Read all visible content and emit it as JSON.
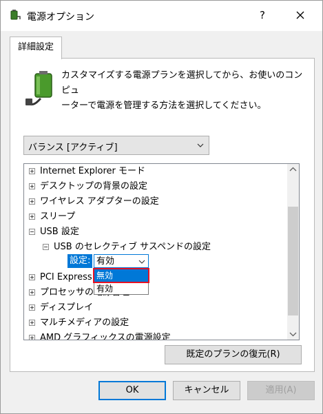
{
  "window": {
    "title": "電源オプション",
    "help_label": "?",
    "close_icon": "close-icon",
    "title_icon": "power-options-icon"
  },
  "tabs": [
    {
      "label": "詳細設定",
      "selected": true
    }
  ],
  "panel": {
    "description_line1": "カスタマイズする電源プランを選択してから、お使いのコンピュ",
    "description_line2": "ーターで電源を管理する方法を選択してください。",
    "icon": "battery-plug-icon"
  },
  "plan_select": {
    "value": "バランス [アクティブ]"
  },
  "tree": {
    "items": [
      {
        "label": "Internet Explorer モード",
        "expander": "plus"
      },
      {
        "label": "デスクトップの背景の設定",
        "expander": "plus"
      },
      {
        "label": "ワイヤレス アダプターの設定",
        "expander": "plus"
      },
      {
        "label": "スリープ",
        "expander": "plus"
      },
      {
        "label": "USB 設定",
        "expander": "minus"
      },
      {
        "label": "USB のセレクティブ サスペンドの設定",
        "expander": "minus"
      },
      {
        "label": "PCI Express",
        "expander": "plus"
      },
      {
        "label": "プロセッサの電源管理",
        "expander": "plus"
      },
      {
        "label": "ディスプレイ",
        "expander": "plus"
      },
      {
        "label": "マルチメディアの設定",
        "expander": "plus"
      },
      {
        "label": "AMD グラフィックスの電源設定",
        "expander": "plus"
      }
    ],
    "setting": {
      "label": "設定:",
      "value": "有効",
      "options": [
        "無効",
        "有効"
      ],
      "highlighted": "無効"
    }
  },
  "buttons": {
    "restore": "既定のプランの復元(R)",
    "ok": "OK",
    "cancel": "キャンセル",
    "apply": "適用(A)"
  },
  "colors": {
    "accent": "#0078d7",
    "highlight_border": "#e81123"
  }
}
